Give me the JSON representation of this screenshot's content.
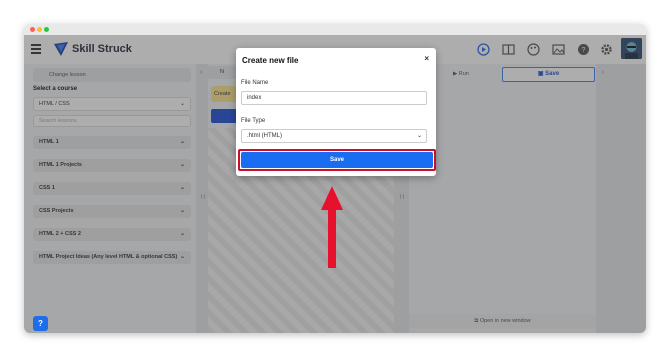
{
  "app": {
    "brand": "Skill Struck"
  },
  "header": {
    "icons": [
      "play-icon",
      "book-icon",
      "palette-icon",
      "image-icon",
      "help-icon",
      "gear-icon"
    ]
  },
  "sidebar": {
    "change_lesson": "Change lesson",
    "select_course_label": "Select a course",
    "course_value": "HTML / CSS",
    "search_placeholder": "Search lessons",
    "sections": [
      "HTML 1",
      "HTML 1 Projects",
      "CSS 1",
      "CSS Projects",
      "HTML 2 + CSS 2",
      "HTML Project Ideas (Any level HTML & optional CSS)"
    ]
  },
  "editor": {
    "tab_label": "N",
    "create_label": "Create"
  },
  "preview": {
    "run_label": "Run",
    "save_label": "Save",
    "open_new_window": "Open in new window"
  },
  "help_button": "?",
  "modal": {
    "title": "Create new file",
    "close": "×",
    "file_name_label": "File Name",
    "file_name_value": "index",
    "file_type_label": "File Type",
    "file_type_value": ".html (HTML)",
    "save_label": "Save"
  },
  "colors": {
    "primary": "#1a6cf0",
    "highlight": "#c8102e",
    "arrow": "#e8112d"
  }
}
